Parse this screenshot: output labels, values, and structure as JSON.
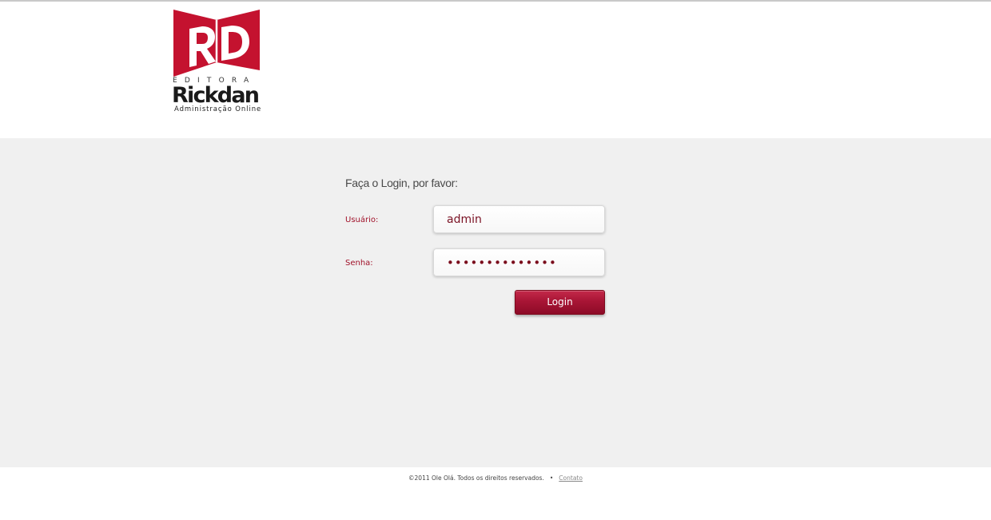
{
  "brand": {
    "monogram": "RD",
    "editora": "EDITORA",
    "name": "Rickdan",
    "subtitle": "Administração Online",
    "accent_color": "#c4122f"
  },
  "login": {
    "title": "Faça o Login, por favor:",
    "username_label": "Usuário:",
    "username_value": "admin",
    "password_label": "Senha:",
    "password_value": "••••••••••••••",
    "button_label": "Login"
  },
  "footer": {
    "copyright": "©2011 Ole Olá. Todos os direitos reservados.",
    "separator": "•",
    "contact_link": "Contato"
  }
}
